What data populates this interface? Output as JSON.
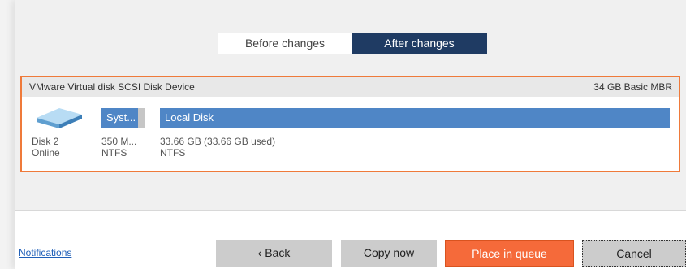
{
  "view_toggle": {
    "before_label": "Before changes",
    "after_label": "After changes",
    "selected": "After changes"
  },
  "disk": {
    "device_name": "VMware Virtual disk SCSI Disk Device",
    "size_info": "34 GB Basic MBR",
    "disk_label": "Disk 2",
    "status": "Online",
    "icon": "hard-drive-icon",
    "partitions": [
      {
        "name": "Syst...",
        "size": "350 M...",
        "fs": "NTFS"
      },
      {
        "name": "Local Disk",
        "size": "33.66 GB (33.66 GB used)",
        "fs": "NTFS"
      }
    ]
  },
  "footer": {
    "notifications_label": "Notifications",
    "back_label": "‹ Back",
    "copy_now_label": "Copy now",
    "place_in_queue_label": "Place in queue",
    "cancel_label": "Cancel"
  },
  "colors": {
    "accent_orange": "#f56a3a",
    "selection_border": "#ef7a3a",
    "partition_blue": "#4f86c6",
    "toggle_navy": "#1f3b63"
  }
}
